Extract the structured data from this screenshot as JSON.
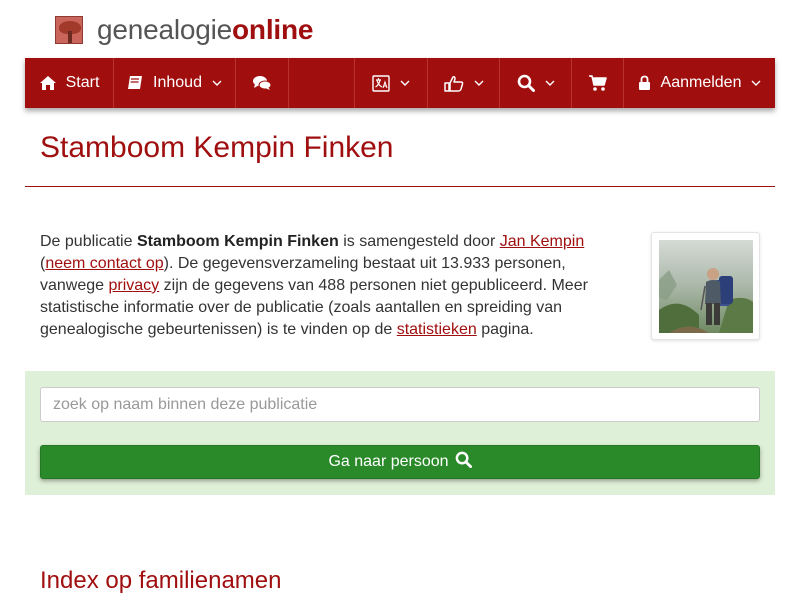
{
  "header": {
    "logo_part1": "genealogie",
    "logo_part2": "online"
  },
  "navbar": {
    "start_label": "Start",
    "inhoud_label": "Inhoud",
    "aanmelden_label": "Aanmelden",
    "icons": [
      "home-icon",
      "book-icon",
      "comments-icon",
      "language-icon",
      "thumbs-up-icon",
      "search-icon",
      "shopping-cart-icon",
      "lock-icon",
      "chevron-down-icon"
    ]
  },
  "page": {
    "title": "Stamboom Kempin Finken"
  },
  "description": {
    "p1": "De publicatie ",
    "publication": "Stamboom Kempin Finken",
    "p2": " is samengesteld door ",
    "author": "Jan Kempin",
    "p3": " (",
    "contact": "neem contact op",
    "p4": "). De gegevensverzameling bestaat uit 13.933 personen, vanwege ",
    "privacy": "privacy",
    "p5": " zijn de gegevens van 488 personen niet gepubliceerd. Meer statistische informatie over de publicatie (zoals aantallen en spreiding van genealogische gebeurtenissen) is te vinden op de ",
    "stats": "statistieken",
    "p6": " pagina."
  },
  "search": {
    "placeholder": "zoek op naam binnen deze publicatie",
    "value": "",
    "button_label": "Ga naar persoon"
  },
  "index": {
    "heading": "Index op familienamen"
  },
  "colors": {
    "brand_red": "#a10e0e",
    "panel_green": "#dff0d8",
    "button_green": "#2a8a2a"
  }
}
